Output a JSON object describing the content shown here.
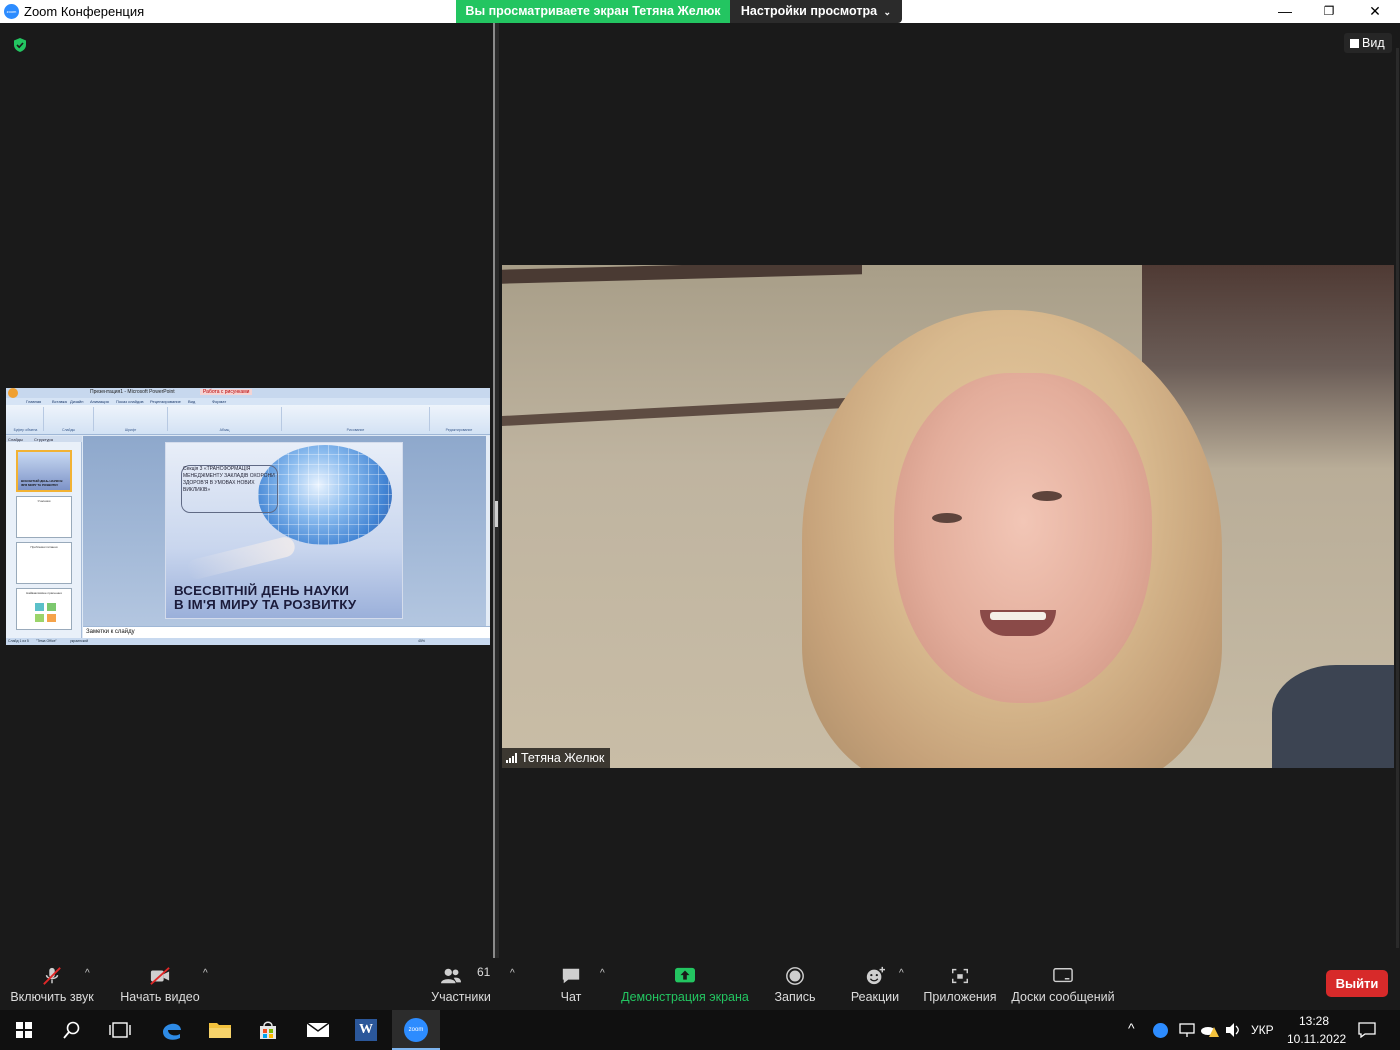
{
  "window": {
    "title": "Zoom Конференция",
    "app_logo_text": "zoom",
    "share_banner": "Вы просматриваете экран Тетяна Желюк",
    "view_options": "Настройки просмотра",
    "controls": {
      "minimize": "—",
      "restore": "❐",
      "close": "✕"
    }
  },
  "view_button": {
    "label": "Вид"
  },
  "participant": {
    "name": "Тетяна Желюк"
  },
  "shared_screen": {
    "title": "Презентация1 - Microsoft PowerPoint",
    "context_tab": "Работа с рисунками",
    "tabs": [
      "Главная",
      "Вставка",
      "Дизайн",
      "Анимация",
      "Показ слайдов",
      "Рецензирование",
      "Вид",
      "Формат"
    ],
    "ribbon_groups": [
      "Буфер обмена",
      "Слайды",
      "Шрифт",
      "Абзац",
      "Рисование",
      "Редактирование"
    ],
    "panel_tabs": [
      "Слайды",
      "Структура"
    ],
    "thumbnails": [
      "ВСЕСВІТНІЙ ДЕНЬ НАУКИ В ІМ'Я МИРУ ТА РОЗВИТКУ",
      "Учасники",
      "Проблемні питання",
      "Найважливіше прагнення"
    ],
    "slide": {
      "subtitle": "Секція 3 «ТРАНСФОРМАЦІЯ МЕНЕДЖМЕНТУ ЗАКЛАДІВ ОХОРОНИ ЗДОРОВ'Я В УМОВАХ НОВИХ ВИКЛИКІВ»",
      "title_line1": "ВСЕСВІТНІЙ ДЕНЬ НАУКИ",
      "title_line2": "В ІМ'Я МИРУ ТА РОЗВИТКУ"
    },
    "notes": "Заметки к слайду",
    "status": {
      "slide": "Слайд 1 из 5",
      "theme": "\"Тема Office\"",
      "lang": "украинский",
      "zoom": "45%"
    }
  },
  "toolbar": {
    "mute": "Включить звук",
    "video": "Начать видео",
    "participants": "Участники",
    "participants_count": "61",
    "chat": "Чат",
    "share": "Демонстрация экрана",
    "record": "Запись",
    "reactions": "Реакции",
    "apps": "Приложения",
    "whiteboards": "Доски сообщений",
    "leave": "Выйти"
  },
  "taskbar": {
    "zoom_label": "zoom",
    "word_label": "W",
    "language": "УКР",
    "time": "13:28",
    "date": "10.11.2022"
  },
  "colors": {
    "accent_green": "#23c561",
    "leave_red": "#d72a2a",
    "zoom_blue": "#2d8cff"
  }
}
